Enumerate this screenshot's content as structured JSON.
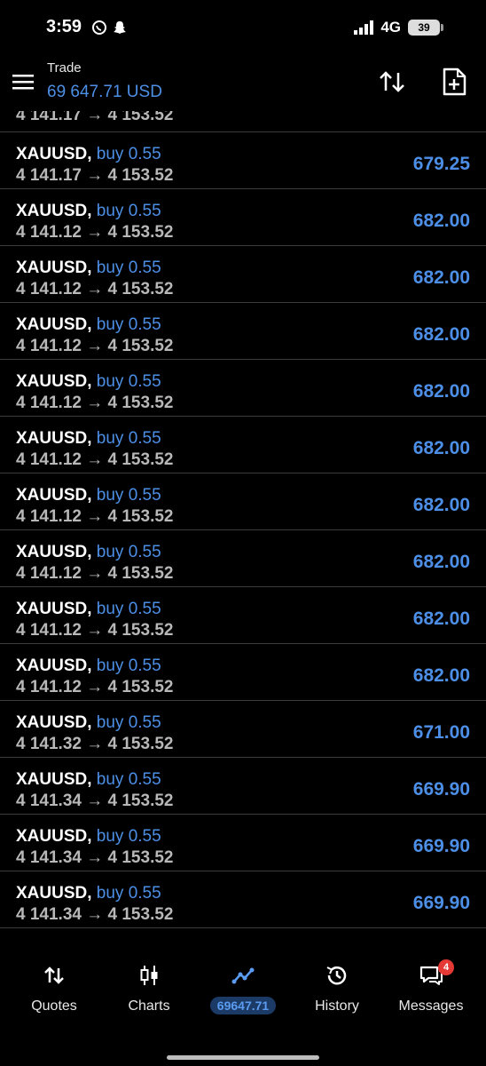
{
  "status_bar": {
    "time": "3:59",
    "network": "4G",
    "battery": "39"
  },
  "header": {
    "title": "Trade",
    "balance": "69 647.71 USD"
  },
  "partial_row": {
    "prices": "4 141.17 → 4 153.52"
  },
  "positions": [
    {
      "symbol": "XAUUSD,",
      "action": "buy 0.55",
      "prices": "4 141.17 → 4 153.52",
      "profit": "679.25"
    },
    {
      "symbol": "XAUUSD,",
      "action": "buy 0.55",
      "prices": "4 141.12 → 4 153.52",
      "profit": "682.00"
    },
    {
      "symbol": "XAUUSD,",
      "action": "buy 0.55",
      "prices": "4 141.12 → 4 153.52",
      "profit": "682.00"
    },
    {
      "symbol": "XAUUSD,",
      "action": "buy 0.55",
      "prices": "4 141.12 → 4 153.52",
      "profit": "682.00"
    },
    {
      "symbol": "XAUUSD,",
      "action": "buy 0.55",
      "prices": "4 141.12 → 4 153.52",
      "profit": "682.00"
    },
    {
      "symbol": "XAUUSD,",
      "action": "buy 0.55",
      "prices": "4 141.12 → 4 153.52",
      "profit": "682.00"
    },
    {
      "symbol": "XAUUSD,",
      "action": "buy 0.55",
      "prices": "4 141.12 → 4 153.52",
      "profit": "682.00"
    },
    {
      "symbol": "XAUUSD,",
      "action": "buy 0.55",
      "prices": "4 141.12 → 4 153.52",
      "profit": "682.00"
    },
    {
      "symbol": "XAUUSD,",
      "action": "buy 0.55",
      "prices": "4 141.12 → 4 153.52",
      "profit": "682.00"
    },
    {
      "symbol": "XAUUSD,",
      "action": "buy 0.55",
      "prices": "4 141.12 → 4 153.52",
      "profit": "682.00"
    },
    {
      "symbol": "XAUUSD,",
      "action": "buy 0.55",
      "prices": "4 141.32 → 4 153.52",
      "profit": "671.00"
    },
    {
      "symbol": "XAUUSD,",
      "action": "buy 0.55",
      "prices": "4 141.34 → 4 153.52",
      "profit": "669.90"
    },
    {
      "symbol": "XAUUSD,",
      "action": "buy 0.55",
      "prices": "4 141.34 → 4 153.52",
      "profit": "669.90"
    },
    {
      "symbol": "XAUUSD,",
      "action": "buy 0.55",
      "prices": "4 141.34 → 4 153.52",
      "profit": "669.90"
    }
  ],
  "nav": {
    "quotes": "Quotes",
    "charts": "Charts",
    "trade": "69647.71",
    "history": "History",
    "messages": "Messages",
    "messages_badge": "4"
  },
  "colors": {
    "accent": "#4d8fe6",
    "background": "#000000",
    "divider": "#3a3a3a",
    "badge": "#e53935"
  }
}
